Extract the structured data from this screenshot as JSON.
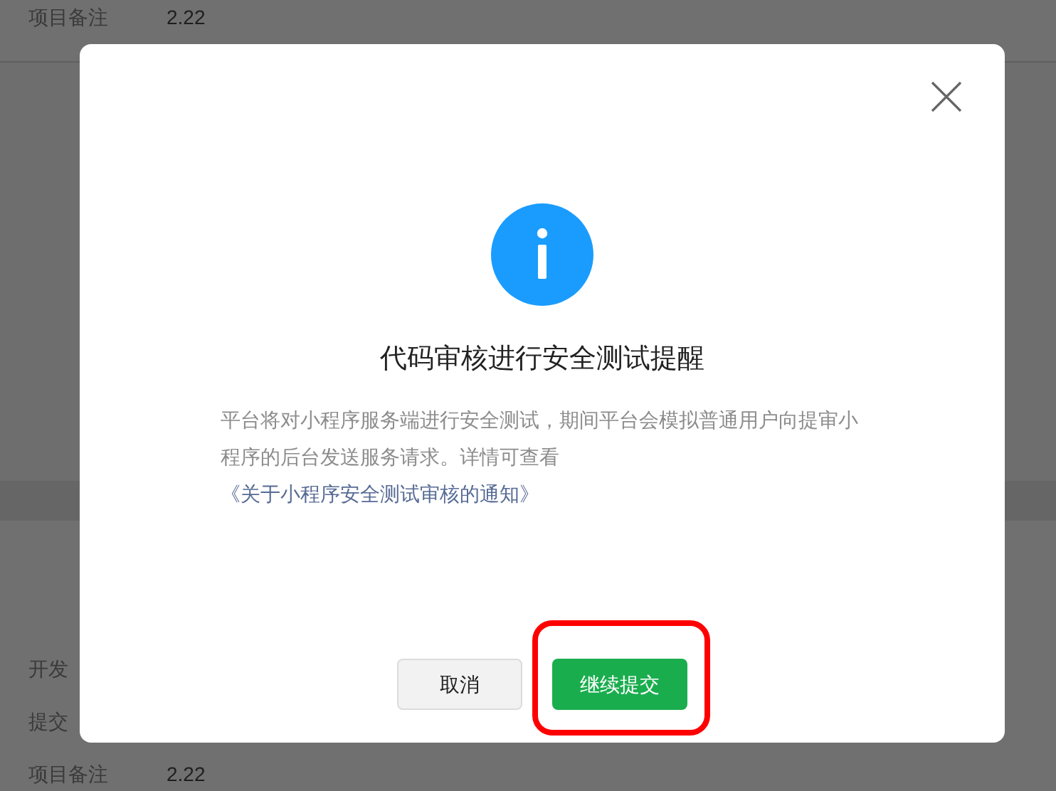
{
  "background": {
    "rows": [
      {
        "label": "项目备注",
        "value": "2.22"
      },
      {
        "label": "开发"
      },
      {
        "label": "提交"
      },
      {
        "label": "项目备注",
        "value": "2.22"
      }
    ]
  },
  "dialog": {
    "title": "代码审核进行安全测试提醒",
    "body": {
      "text": "平台将对小程序服务端进行安全测试，期间平台会模拟普通用户向提审小程序的后台发送服务请求。详情可查看",
      "link": "《关于小程序安全测试审核的通知》"
    },
    "buttons": [
      {
        "label": "取消",
        "kind": "secondary"
      },
      {
        "label": "继续提交",
        "kind": "primary",
        "highlighted": true
      }
    ]
  }
}
